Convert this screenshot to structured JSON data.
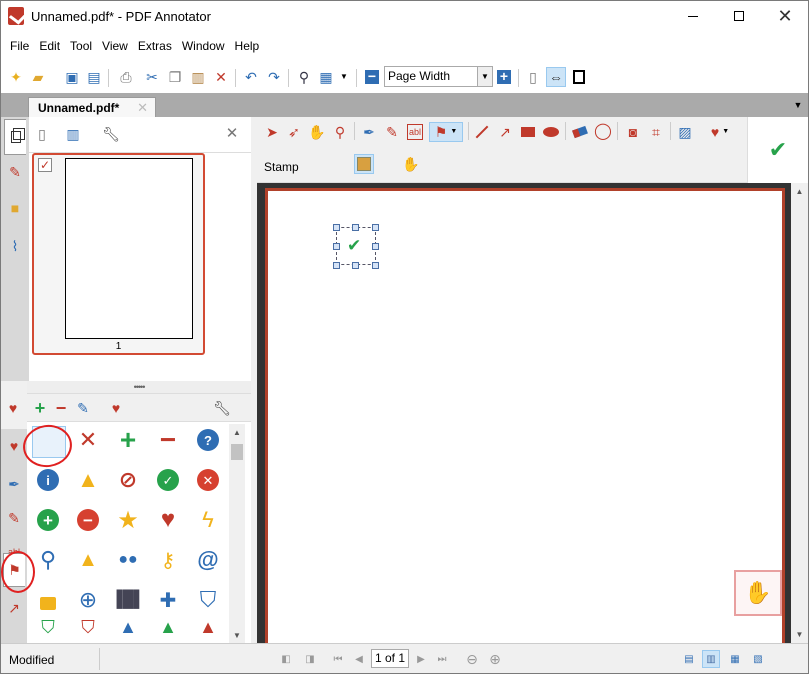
{
  "window": {
    "title": "Unnamed.pdf* - PDF Annotator"
  },
  "menu": [
    "File",
    "Edit",
    "Tool",
    "View",
    "Extras",
    "Window",
    "Help"
  ],
  "toolbar": {
    "zoom_value": "Page Width"
  },
  "tabs": {
    "doc_tab": "Unnamed.pdf*",
    "close": "✕"
  },
  "thumbnails": {
    "page_number": "1"
  },
  "annotation_bar": {
    "stamp_label": "Stamp"
  },
  "status": {
    "text": "Modified",
    "page_indicator": "1 of 1"
  },
  "colors": {
    "accent_red": "#c0392b",
    "stamp_green": "#27a24b",
    "info_blue": "#2f6db3"
  },
  "icons": {
    "favorites_grid": [
      "check-icon",
      "x-icon",
      "plus-icon",
      "minus-icon",
      "help-icon",
      "info-icon",
      "warning-icon",
      "forbidden-icon",
      "ok-circle-icon",
      "cancel-circle-icon",
      "plus-circle-icon",
      "minus-circle-icon",
      "star-icon",
      "heart-icon",
      "lightning-icon",
      "magnifier-icon",
      "bell-icon",
      "footprints-icon",
      "key-icon",
      "at-icon",
      "lock-icon",
      "globe-icon",
      "binoculars-icon",
      "puzzle-icon",
      "shield-icon"
    ]
  }
}
